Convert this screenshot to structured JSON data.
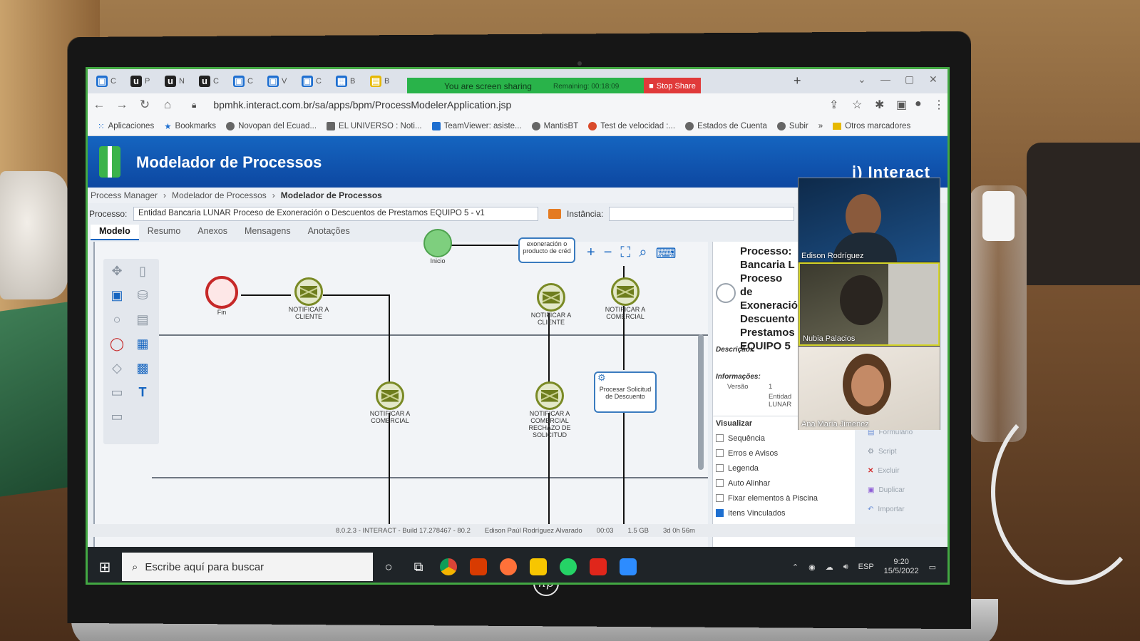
{
  "browser": {
    "tabs": [
      {
        "letter": "C",
        "color": "#1e6fd0"
      },
      {
        "letter": "P",
        "color": "#222"
      },
      {
        "letter": "N",
        "color": "#222"
      },
      {
        "letter": "C",
        "color": "#222"
      },
      {
        "letter": "C",
        "color": "#1e6fd0"
      },
      {
        "letter": "V",
        "color": "#1e6fd0"
      },
      {
        "letter": "C",
        "color": "#1e6fd0"
      },
      {
        "letter": "B",
        "color": "#1e6fd0"
      },
      {
        "letter": "B",
        "color": "#e6b800"
      }
    ],
    "share_banner": "You are screen sharing",
    "share_remaining": "Remaining: 00:18:09",
    "stop_share": "Stop Share",
    "url": "bpmhk.interact.com.br/sa/apps/bpm/ProcessModelerApplication.jsp",
    "bookmarks": [
      "Aplicaciones",
      "Bookmarks",
      "Novopan del Ecuad...",
      "EL UNIVERSO : Noti...",
      "TeamViewer: asiste...",
      "MantisBT",
      "Test de velocidad :...",
      "Estados de Cuenta",
      "Subir",
      "»",
      "Otros marcadores"
    ]
  },
  "app": {
    "title": "Modelador de Processos",
    "brand": "ⅰ) Interact",
    "breadcrumb": [
      "Process Manager",
      "Modelador de Processos",
      "Modelador de Processos"
    ],
    "processo_label": "Processo:",
    "processo_value": "Entidad Bancaria LUNAR Proceso de Exoneración o Descuentos de Prestamos EQUIPO 5 - v1",
    "instancia_label": "Instância:",
    "tabs": [
      "Modelo",
      "Resumo",
      "Anexos",
      "Mensagens",
      "Anotações"
    ]
  },
  "diagram": {
    "nodes": {
      "fin": "Fin",
      "inicio": "Inicio",
      "notify_client_1": "NOTIFICAR A CLIENTE",
      "notify_client_2": "NOTIFICAR A CLIENTE",
      "notify_commercial_1": "NOTIFICAR A COMERCIAL",
      "notify_commercial_2": "NOTIFICAR A COMERCIAL",
      "notify_commercial_reject": "NOTIFICAR A COMERCIAL RECHAZO DE SOLICITUD",
      "process_request": "Procesar Solicitud de Descuento",
      "top_task": "exoneración o producto de créd"
    }
  },
  "props": {
    "title": "Processo: Bancaria L Proceso de Exoneració Descuento Prestamos EQUIPO 5",
    "descricao_label": "Descrição:",
    "informacoes_label": "Informações:",
    "versao_label": "Versão",
    "versao_value": "1",
    "entidad_value": "Entidad LUNAR",
    "visualizar_title": "Visualizar",
    "options": [
      {
        "label": "Sequência",
        "checked": false
      },
      {
        "label": "Erros e Avisos",
        "checked": false
      },
      {
        "label": "Legenda",
        "checked": false
      },
      {
        "label": "Auto Alinhar",
        "checked": false
      },
      {
        "label": "Fixar elementos à Piscina",
        "checked": false
      },
      {
        "label": "Itens Vinculados",
        "checked": true
      }
    ],
    "actions": [
      "Formulário",
      "Script",
      "Excluir",
      "Duplicar",
      "Importar"
    ]
  },
  "video": {
    "participants": [
      "Edison Rodríguez",
      "Nubia Palacios",
      "Ana María Jimenez"
    ]
  },
  "statusbar": {
    "build": "8.0.2.3 - INTERACT - Build 17.278467 - 80.2",
    "user": "Edison Paúl Rodríguez Alvarado",
    "time": "00:03",
    "memory": "1.5 GB",
    "uptime": "3d 0h 56m"
  },
  "taskbar": {
    "search_placeholder": "Escribe aquí para buscar",
    "language": "ESP",
    "time": "9:20",
    "date": "15/5/2022"
  },
  "colors": {
    "header": "#1565c0",
    "share_green": "#29b34a",
    "stop_red": "#e03a3a",
    "end_event": "#c62828",
    "message_event": "#7a8a25"
  }
}
